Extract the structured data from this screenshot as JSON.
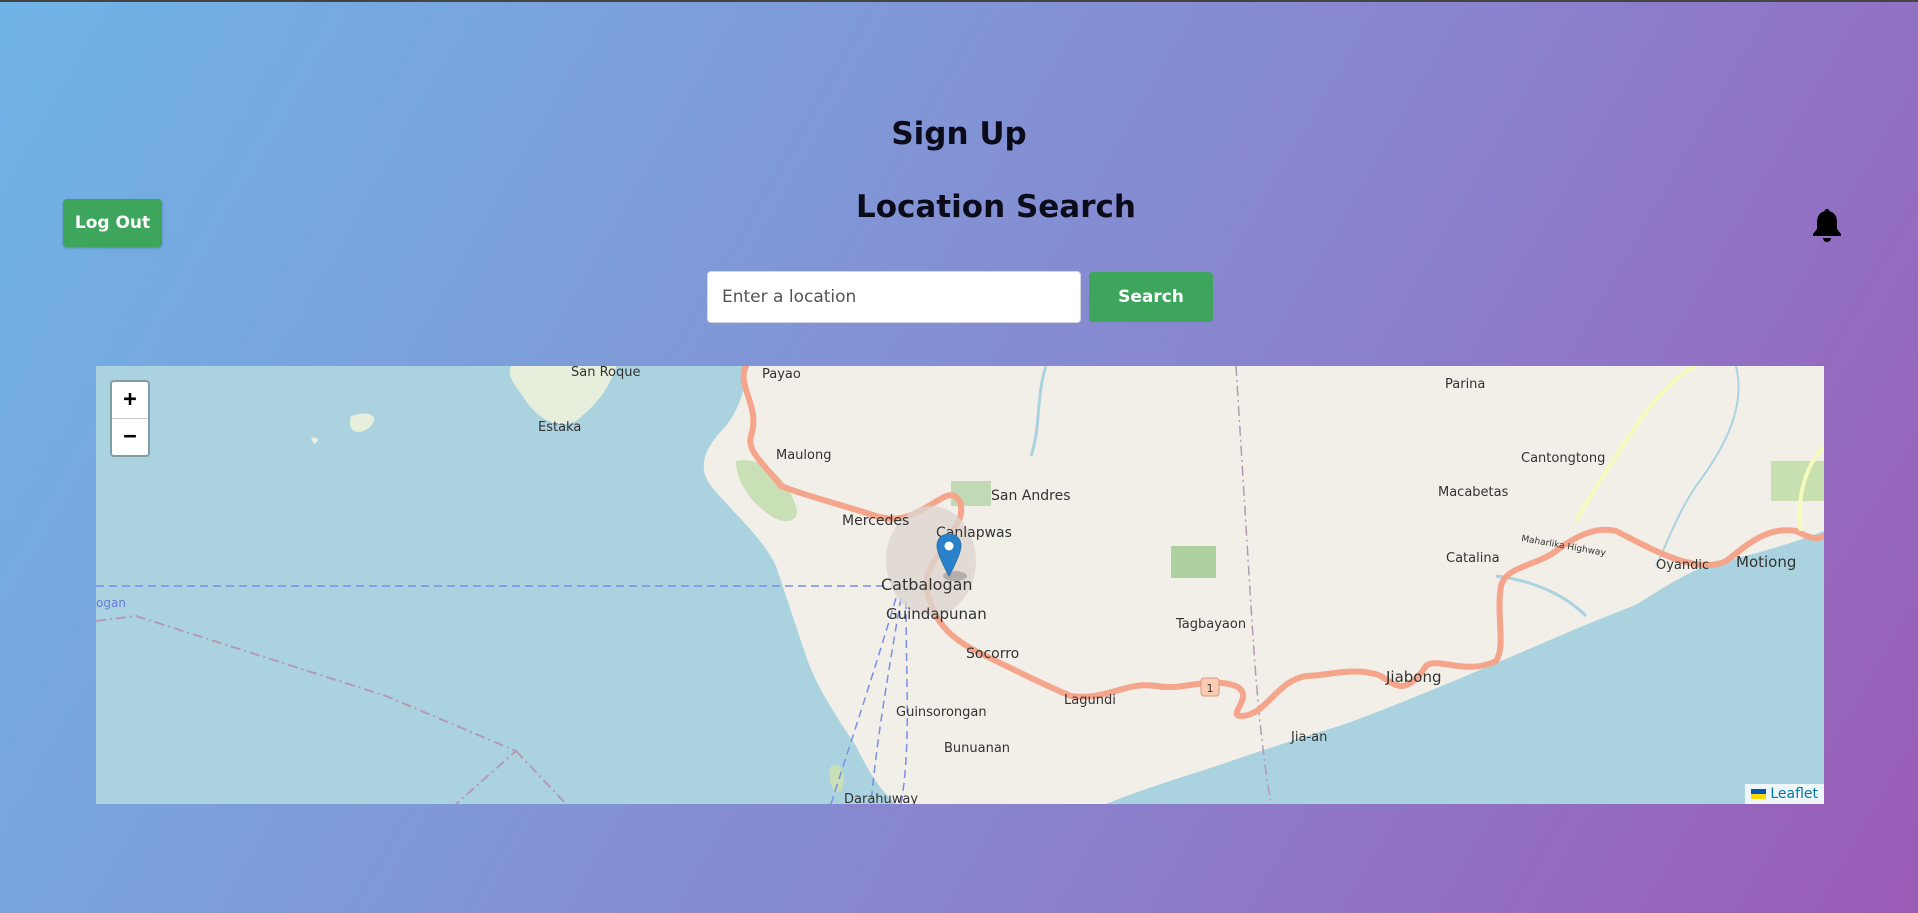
{
  "header": {
    "signup_title": "Sign Up",
    "search_title": "Location Search"
  },
  "logout": {
    "label": "Log Out"
  },
  "notifications": {
    "icon": "bell-icon"
  },
  "search": {
    "placeholder": "Enter a location",
    "value": "",
    "button_label": "Search"
  },
  "map": {
    "zoom_in": "+",
    "zoom_out": "−",
    "attribution": "Leaflet",
    "marker_icon": "map-marker-icon",
    "labels": {
      "san_roque": "San Roque",
      "payao": "Payao",
      "estaka": "Estaka",
      "maulong": "Maulong",
      "san_andres": "San Andres",
      "mercedes": "Mercedes",
      "canlapwas": "Canlapwas",
      "catbalogan": "Catbalogan",
      "guindapunan": "Guindapunan",
      "socorro": "Socorro",
      "guinsorongan": "Guinsorongan",
      "bunuanan": "Bunuanan",
      "darahuway": "Darahuway",
      "lagundi": "Lagundi",
      "tagbayaon": "Tagbayaon",
      "jiabong": "Jiabong",
      "jia_an": "Jia-an",
      "catalina": "Catalina",
      "macabetas": "Macabetas",
      "cantongtong": "Cantongtong",
      "parina": "Parina",
      "oyandic": "Oyandic",
      "motiong": "Motiong",
      "maharlika_highway": "Maharlika Highway",
      "ogan": "ogan",
      "route_shield": "1"
    }
  },
  "colors": {
    "button_green": "#3ea55d",
    "water": "#aad3df",
    "land": "#f2efe9",
    "road": "#f4a58b",
    "marker": "#2a81cb"
  }
}
